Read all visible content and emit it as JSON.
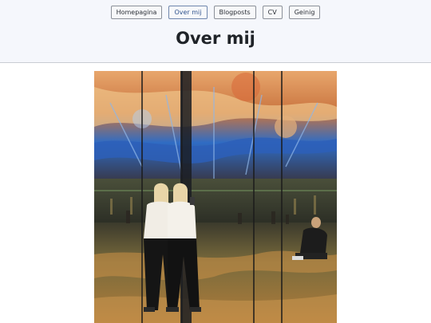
{
  "nav": {
    "items": [
      {
        "label": "Homepagina",
        "active": false
      },
      {
        "label": "Over mij",
        "active": true
      },
      {
        "label": "Blogposts",
        "active": false
      },
      {
        "label": "CV",
        "active": false
      },
      {
        "label": "Geinig",
        "active": false
      }
    ]
  },
  "header": {
    "title": "Over mij"
  },
  "photo": {
    "icon": "mirror-room-photo"
  },
  "colors": {
    "header_bg": "#f5f7fc",
    "active_nav": "#30538f"
  }
}
